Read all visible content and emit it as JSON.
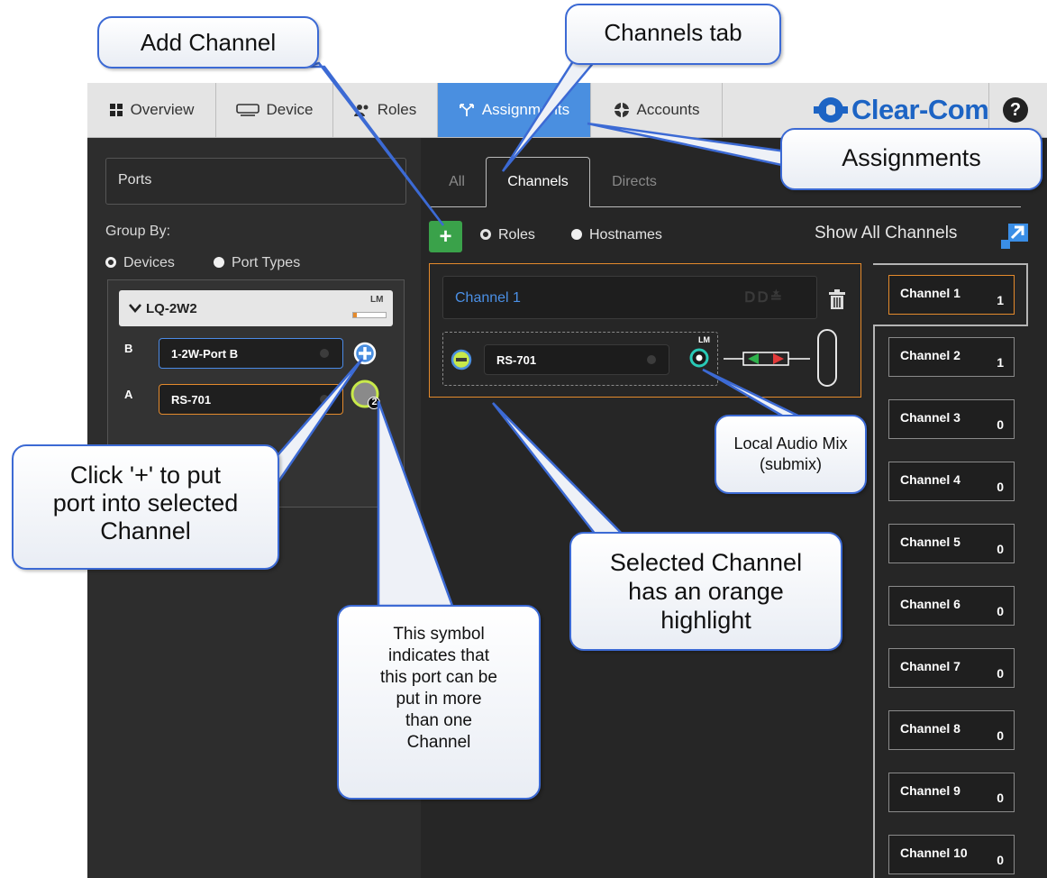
{
  "nav": {
    "tabs": [
      {
        "label": "Overview",
        "icon": "grid-icon"
      },
      {
        "label": "Device",
        "icon": "device-icon"
      },
      {
        "label": "Roles",
        "icon": "roles-icon"
      },
      {
        "label": "Assignments",
        "icon": "assignments-icon",
        "active": true
      },
      {
        "label": "Accounts",
        "icon": "accounts-icon"
      }
    ],
    "logo_text": "Clear-Com",
    "help_label": "?"
  },
  "left_panel": {
    "ports_title": "Ports",
    "group_by_label": "Group By:",
    "group_options": [
      "Devices",
      "Port Types"
    ],
    "group_selected": "Devices",
    "device": {
      "name": "LQ-2W2",
      "badge": "LM",
      "ports": [
        {
          "slot": "B",
          "name": "1-2W-Port B",
          "channel_count": ""
        },
        {
          "slot": "A",
          "name": "RS-701",
          "channel_count": "2"
        }
      ]
    }
  },
  "channel_tabs": [
    "All",
    "Channels",
    "Directs"
  ],
  "channel_tabs_active": "Channels",
  "view_options": [
    "Roles",
    "Hostnames"
  ],
  "view_selected": "Roles",
  "add_label": "+",
  "show_all_label": "Show All Channels",
  "selected_channel": {
    "name": "Channel 1",
    "member_port": "RS-701",
    "mix_badge": "LM"
  },
  "channels": [
    {
      "name": "Channel 1",
      "count": "1"
    },
    {
      "name": "Channel 2",
      "count": "1"
    },
    {
      "name": "Channel 3",
      "count": "0"
    },
    {
      "name": "Channel 4",
      "count": "0"
    },
    {
      "name": "Channel 5",
      "count": "0"
    },
    {
      "name": "Channel 6",
      "count": "0"
    },
    {
      "name": "Channel 7",
      "count": "0"
    },
    {
      "name": "Channel 8",
      "count": "0"
    },
    {
      "name": "Channel 9",
      "count": "0"
    },
    {
      "name": "Channel 10",
      "count": "0"
    }
  ],
  "callouts": {
    "add_channel": "Add Channel",
    "channels_tab": "Channels tab",
    "assignments": "Assignments",
    "click_plus": [
      "Click '+' to put",
      "port into selected",
      "Channel"
    ],
    "local_mix": [
      "Local Audio Mix",
      "(submix)"
    ],
    "selected_channel": [
      "Selected Channel",
      "has an orange",
      "highlight"
    ],
    "symbol": [
      "This symbol",
      "indicates that",
      "this port can be",
      "put in more",
      "than one",
      "Channel"
    ]
  },
  "colors": {
    "accent_blue": "#4a8fe0",
    "selected_orange": "#e48a2c",
    "add_green": "#3aa24a",
    "callout_border": "#3c6ad4",
    "brand_blue": "#1d64c4"
  }
}
